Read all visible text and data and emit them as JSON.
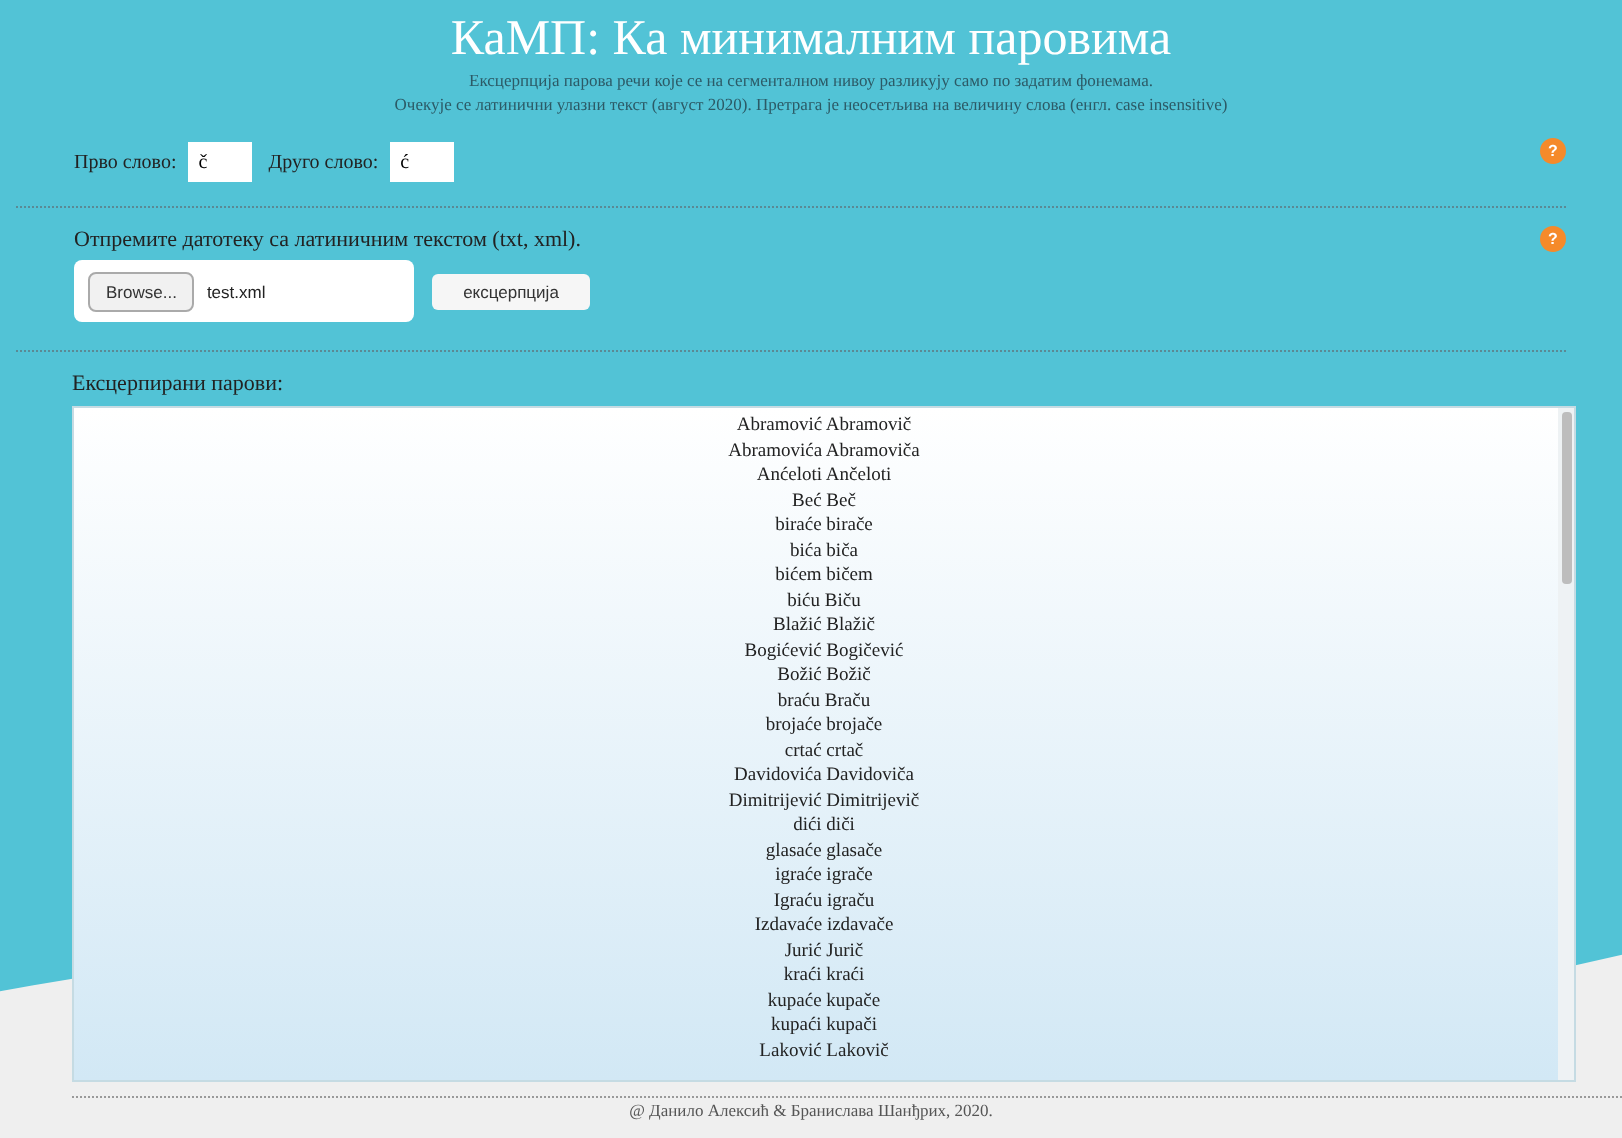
{
  "header": {
    "title": "КаМП: Ка минималним паровима",
    "subtitle_lines": [
      "Ексцерпција парова речи које се на сегменталном нивоу разликују само по задатим фонемама.",
      "Очекује се латинични улазни текст (август 2020). Претрага је неосетљива на величину слова (енгл. case insensitive)"
    ]
  },
  "letters": {
    "first_label": "Прво слово:",
    "first_value": "č",
    "second_label": "Друго слово:",
    "second_value": "ć",
    "help": "?"
  },
  "upload": {
    "label": "Отпремите датотеку са латиничним текстом (txt, xml).",
    "browse": "Browse...",
    "file_name": "test.xml",
    "button": "ексцерпција",
    "help": "?"
  },
  "results": {
    "label": "Ексцерпирани парови:",
    "pairs": [
      "Abramović Abramovič",
      "Abramovića Abramoviča",
      "Anćeloti Ančeloti",
      "Beć Beč",
      "biraće birače",
      "bića biča",
      "bićem bičem",
      "biću Biču",
      "Blažić Blažič",
      "Bogićević Bogičević",
      "Božić Božič",
      "braću Braču",
      "brojaće brojače",
      "crtać crtač",
      "Davidovića Davidoviča",
      "Dimitrijević Dimitrijevič",
      "dići diči",
      "glasaće glasače",
      "igraće igrače",
      "Igraću igraču",
      "Izdavaće izdavače",
      "Jurić Jurič",
      "kraći kraći",
      "kupaće kupače",
      "kupaći kupači",
      "Laković Lakovič"
    ]
  },
  "footer": "@ Данило Алексић & Бранислава Шанђрих, 2020."
}
